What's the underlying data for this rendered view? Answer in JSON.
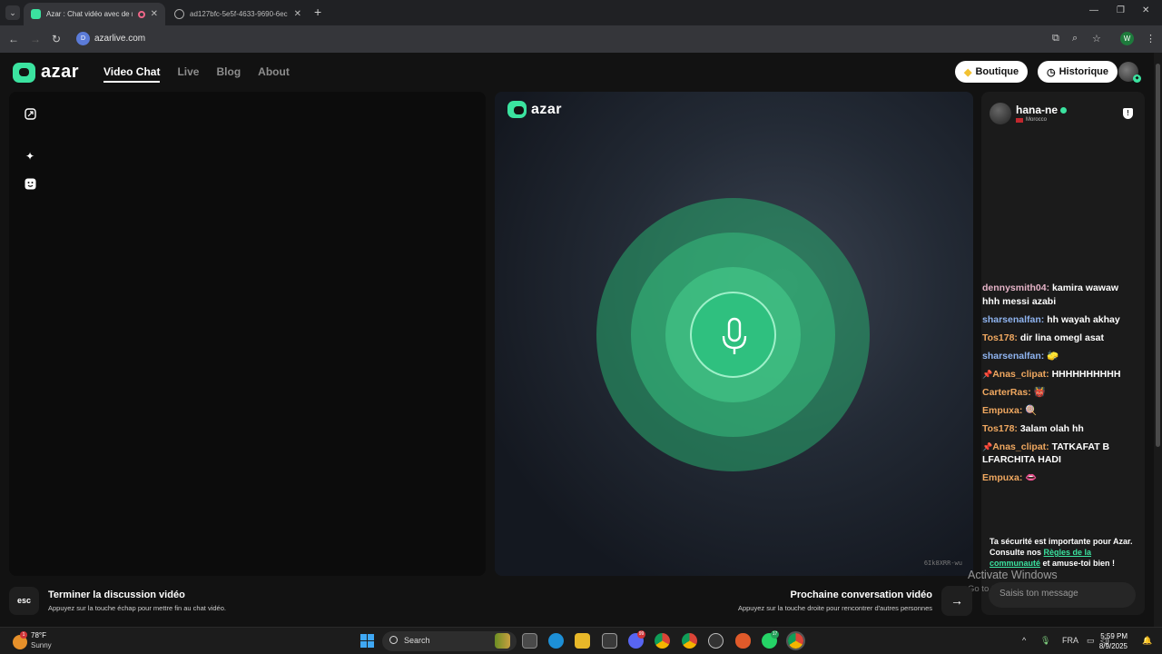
{
  "browser": {
    "tabs": [
      {
        "title": "Azar : Chat vidéo avec de n",
        "active": true
      },
      {
        "title": "ad127bfc-5e5f-4633-9690-6ec",
        "active": false
      }
    ],
    "url": "azarlive.com",
    "url_favicon": "D",
    "profile_initial": "W"
  },
  "site": {
    "logo": "azar",
    "nav": [
      "Video Chat",
      "Live",
      "Blog",
      "About"
    ],
    "shop_label": "Boutique",
    "history_label": "Historique",
    "watermark": "6Ik8XRR-wu"
  },
  "peer": {
    "name": "hana-ne",
    "country": "Morocco"
  },
  "chat": {
    "messages": [
      {
        "user": "dennysmith04:",
        "text": " kamira wawaw hhh messi azabi",
        "color": "#e6b4c8",
        "pin": false
      },
      {
        "user": "sharsenalfan:",
        "text": " hh wayah akhay",
        "color": "#8fb4f0",
        "pin": false
      },
      {
        "user": "Tos178:",
        "text": " dir lina omegl asat",
        "color": "#f0a860",
        "pin": false
      },
      {
        "user": "sharsenalfan:",
        "text": " 🧽",
        "color": "#8fb4f0",
        "pin": false
      },
      {
        "user": "Anas_clipat:",
        "text": " HHHHHHHHHH",
        "color": "#f0a860",
        "pin": true
      },
      {
        "user": "CarterRas:",
        "text": " 👹",
        "color": "#f0a860",
        "pin": false
      },
      {
        "user": "Empuxa:",
        "text": " 🍭",
        "color": "#f0a860",
        "pin": false
      },
      {
        "user": "Tos178:",
        "text": " 3alam olah hh",
        "color": "#f0a860",
        "pin": false
      },
      {
        "user": "Anas_clipat:",
        "text": " TATKAFAT B LFARCHITA HADI",
        "color": "#f0a860",
        "pin": true
      },
      {
        "user": "Empuxa:",
        "text": " 👄",
        "color": "#f0a860",
        "pin": false
      }
    ],
    "safety_a": "Ta sécurité est importante pour Azar. Consulte nos ",
    "safety_link": "Règles de la communauté",
    "safety_b": " et amuse-toi bien !",
    "input_placeholder": "Saisis ton message"
  },
  "overlay": {
    "activate_title": "Activate Windows",
    "activate_sub": "Go to Settings to activate Windows."
  },
  "controls": {
    "esc_key": "esc",
    "end_title": "Terminer la discussion vidéo",
    "end_sub": "Appuyez sur la touche échap pour mettre fin au chat vidéo.",
    "next_title": "Prochaine conversation vidéo",
    "next_sub": "Appuyez sur la touche droite pour rencontrer d'autres personnes"
  },
  "taskbar": {
    "temp": "78°F",
    "condition": "Sunny",
    "weather_badge": "1",
    "search": "Search",
    "lang": "FRA",
    "time": "5:59 PM",
    "date": "8/9/2025",
    "badge_discord": "99",
    "badge_whatsapp": "17"
  },
  "colors": {
    "accent": "#3be3a0",
    "background": "#121212"
  }
}
